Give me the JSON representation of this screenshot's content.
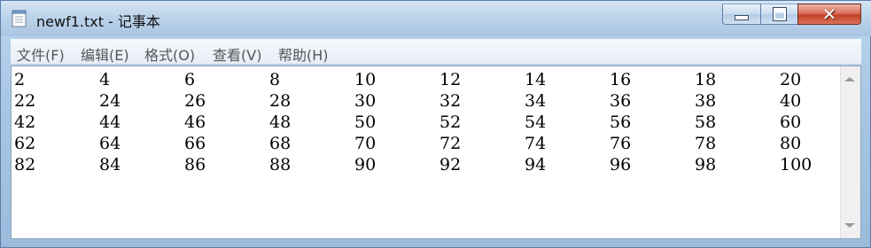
{
  "window": {
    "title": "newf1.txt - 记事本",
    "icon": "notepad-icon",
    "controls": {
      "minimize": "minimize-icon",
      "maximize": "maximize-icon",
      "close": "close-icon"
    }
  },
  "menu": {
    "items": [
      {
        "label": "文件(F)"
      },
      {
        "label": "编辑(E)"
      },
      {
        "label": "格式(O)"
      },
      {
        "label": "查看(V)"
      },
      {
        "label": "帮助(H)"
      }
    ]
  },
  "document": {
    "rows": [
      [
        "2",
        "4",
        "6",
        "8",
        "10",
        "12",
        "14",
        "16",
        "18",
        "20"
      ],
      [
        "22",
        "24",
        "26",
        "28",
        "30",
        "32",
        "34",
        "36",
        "38",
        "40"
      ],
      [
        "42",
        "44",
        "46",
        "48",
        "50",
        "52",
        "54",
        "56",
        "58",
        "60"
      ],
      [
        "62",
        "64",
        "66",
        "68",
        "70",
        "72",
        "74",
        "76",
        "78",
        "80"
      ],
      [
        "82",
        "84",
        "86",
        "88",
        "90",
        "92",
        "94",
        "96",
        "98",
        "100"
      ]
    ]
  },
  "colors": {
    "titlebar": "#bcd3ea",
    "close_button": "#c24126",
    "menubar": "#eef3f9",
    "editor_background": "#ffffff"
  }
}
